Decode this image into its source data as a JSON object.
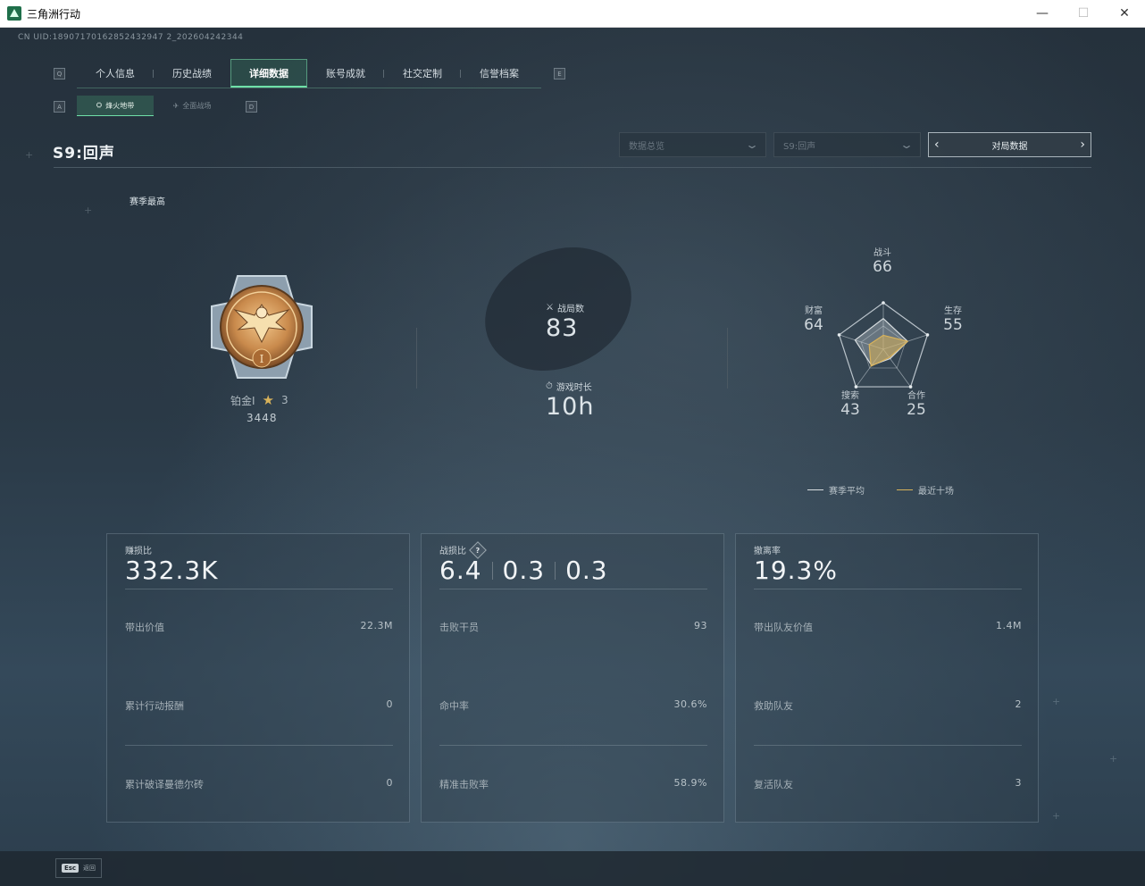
{
  "window": {
    "title": "三角洲行动",
    "minimize_glyph": "—",
    "maximize_glyph": "☐",
    "close_glyph": "✕"
  },
  "uid": "CN UID:18907170162852432947 2_202604242344",
  "key_hints": {
    "tab_prev": "Q",
    "tab_next": "E",
    "sub_prev": "A",
    "sub_next": "D"
  },
  "tabs": [
    {
      "label": "个人信息"
    },
    {
      "label": "历史战绩"
    },
    {
      "label": "详细数据",
      "active": true
    },
    {
      "label": "账号成就"
    },
    {
      "label": "社交定制"
    },
    {
      "label": "信誉档案"
    }
  ],
  "subtabs": [
    {
      "label": "烽火地带",
      "icon": "flame-zone-icon",
      "active": true
    },
    {
      "label": "全面战场",
      "icon": "battlefield-icon"
    }
  ],
  "season_title": "S9:回声",
  "filters": {
    "data_type": "数据总览",
    "season": "S9:回声",
    "nav_label": "对局数据"
  },
  "season_best": {
    "heading": "赛季最高",
    "rank_name": "铂金I",
    "stars": "3",
    "score": "3448"
  },
  "summary": {
    "matches_label": "战局数",
    "matches_value": "83",
    "playtime_label": "游戏时长",
    "playtime_value": "10h"
  },
  "radar": {
    "axes": [
      {
        "label": "战斗",
        "value": "66"
      },
      {
        "label": "生存",
        "value": "55"
      },
      {
        "label": "合作",
        "value": "25"
      },
      {
        "label": "搜索",
        "value": "43"
      },
      {
        "label": "财富",
        "value": "64"
      }
    ],
    "season_avg": [
      0.66,
      0.55,
      0.25,
      0.43,
      0.64
    ],
    "recent_ten": [
      0.3,
      0.55,
      0.22,
      0.45,
      0.32
    ],
    "legend": [
      {
        "label": "赛季平均",
        "color": "#d8dde0"
      },
      {
        "label": "最近十场",
        "color": "#d8b25a"
      }
    ]
  },
  "cards": [
    {
      "label": "赚损比",
      "big_values": [
        "332.3K"
      ],
      "rows": [
        {
          "label": "带出价值",
          "value": "22.3M"
        },
        {
          "label": "累计行动报酬",
          "value": "0"
        },
        {
          "label": "累计破译曼德尔砖",
          "value": "0"
        }
      ]
    },
    {
      "label": "战损比",
      "help": "?",
      "big_values": [
        "6.4",
        "0.3",
        "0.3"
      ],
      "rows": [
        {
          "label": "击败干员",
          "value": "93"
        },
        {
          "label": "命中率",
          "value": "30.6%"
        },
        {
          "label": "精准击败率",
          "value": "58.9%"
        }
      ]
    },
    {
      "label": "撤离率",
      "big_values": [
        "19.3%"
      ],
      "rows": [
        {
          "label": "带出队友价值",
          "value": "1.4M"
        },
        {
          "label": "救助队友",
          "value": "2"
        },
        {
          "label": "复活队友",
          "value": "3"
        }
      ]
    }
  ],
  "bottom": {
    "esc_key": "Esc",
    "esc_label": "返回"
  },
  "colors": {
    "accent": "#6fe0a8",
    "gold": "#d8b25a"
  }
}
